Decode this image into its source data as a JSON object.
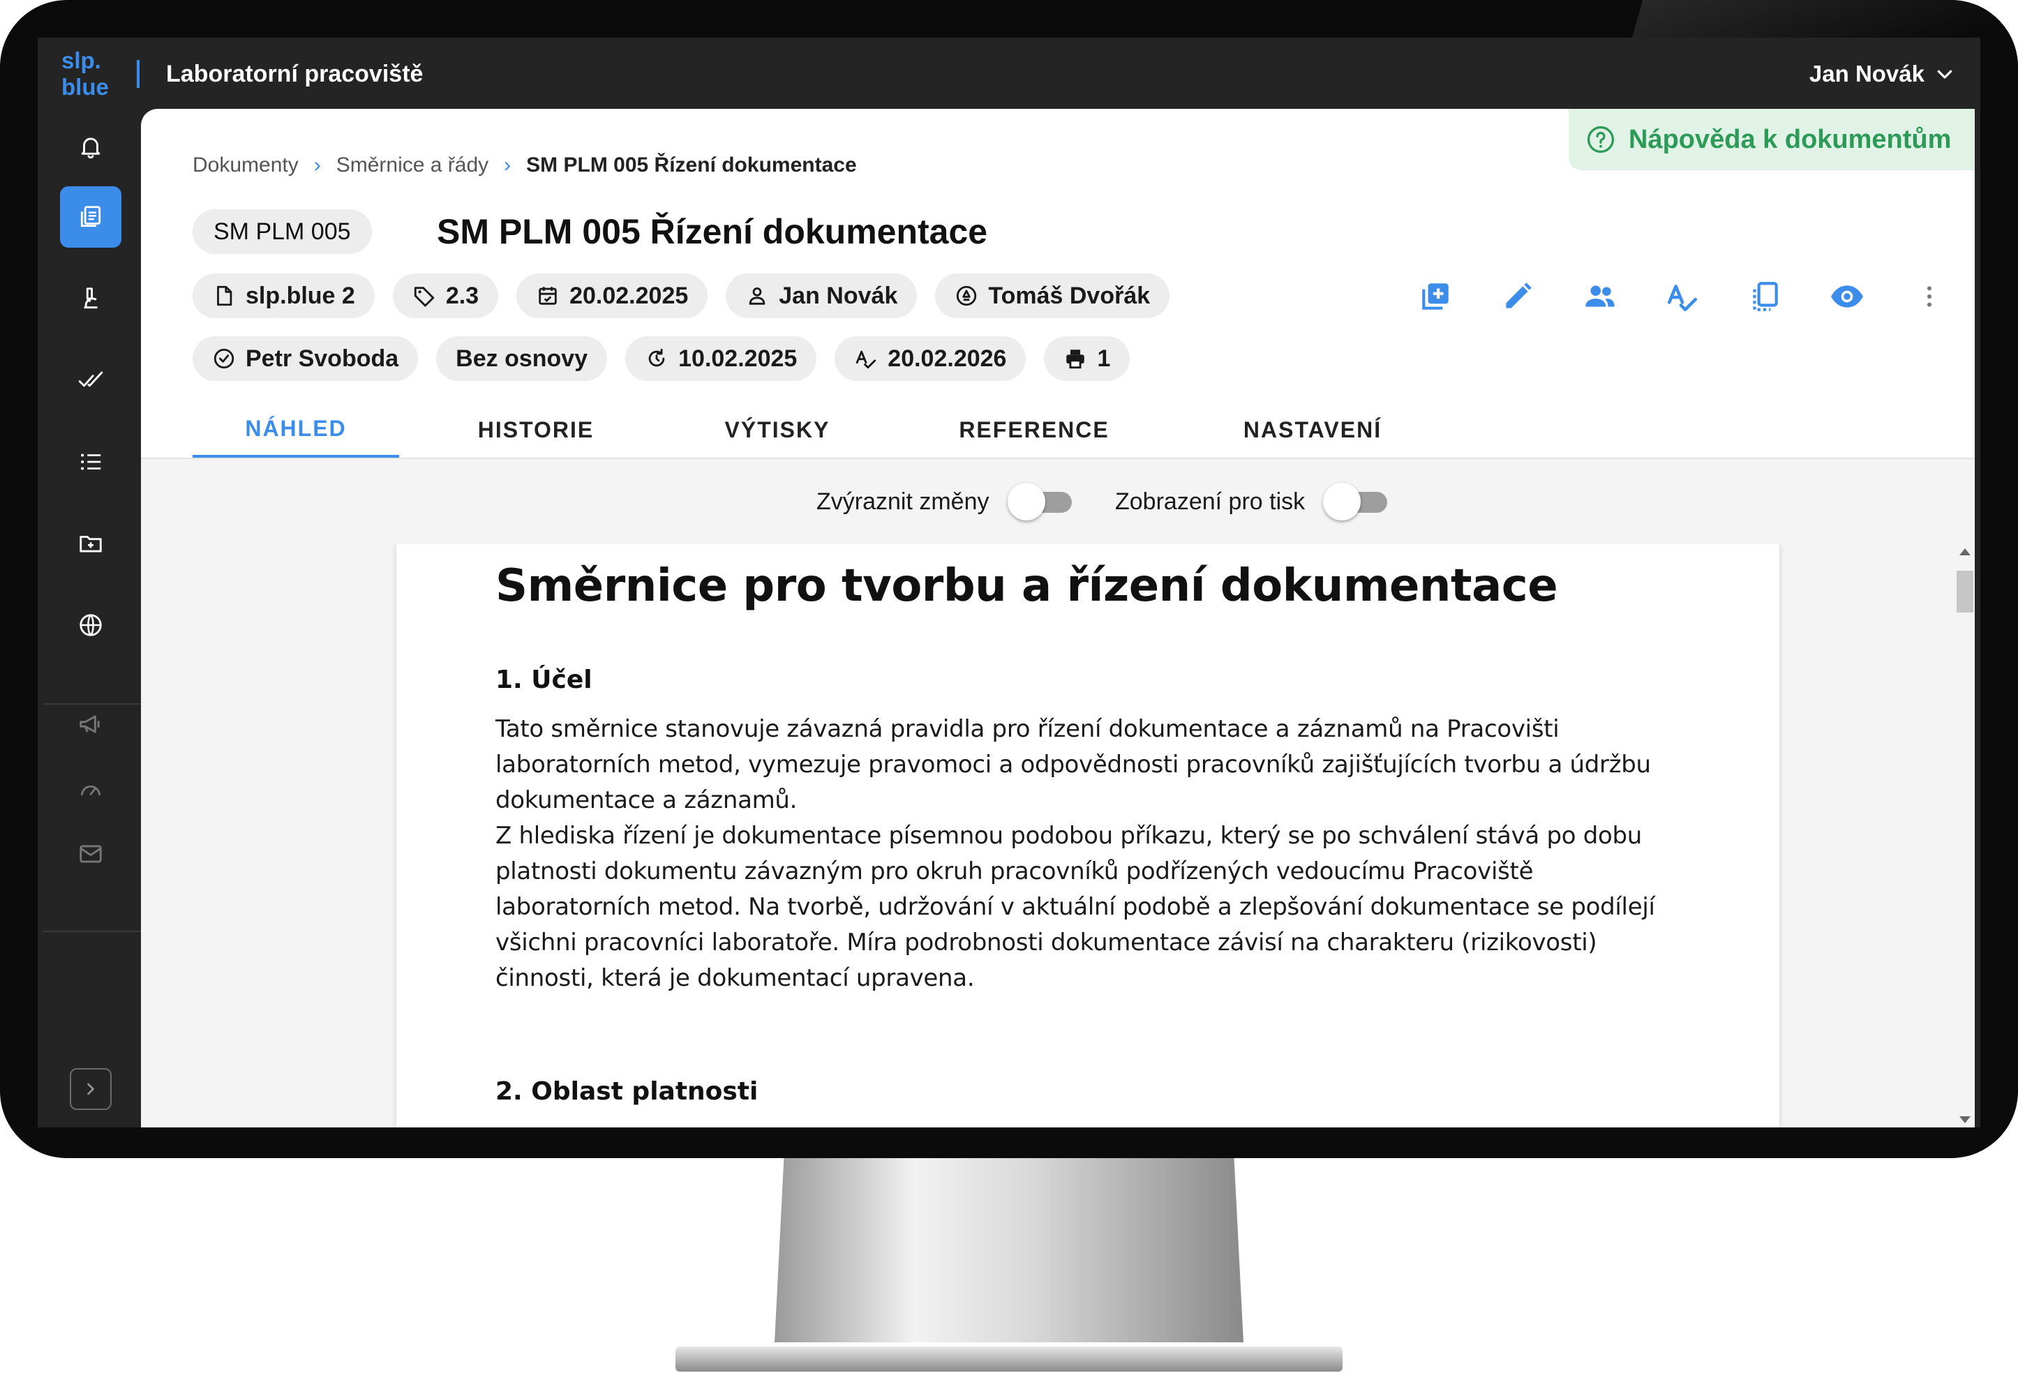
{
  "app": {
    "logo_line1": "slp.",
    "logo_line2": "blue",
    "title": "Laboratorní pracoviště",
    "user_name": "Jan Novák"
  },
  "sidebar": {
    "items": [
      {
        "name": "bell-icon"
      },
      {
        "name": "documents-icon",
        "active": true
      },
      {
        "name": "microscope-icon"
      },
      {
        "name": "double-check-icon"
      },
      {
        "name": "list-icon"
      },
      {
        "name": "folder-add-icon"
      },
      {
        "name": "globe-icon"
      },
      {
        "name": "megaphone-icon"
      },
      {
        "name": "speedometer-icon"
      },
      {
        "name": "mail-icon"
      }
    ],
    "expand_icon": "chevron-right-icon"
  },
  "help": {
    "label": "Nápověda k dokumentům",
    "icon": "help-circle-icon"
  },
  "breadcrumb": [
    {
      "label": "Dokumenty"
    },
    {
      "label": "Směrnice a řády"
    },
    {
      "label": "SM PLM 005 Řízení dokumentace"
    }
  ],
  "document": {
    "code": "SM PLM 005",
    "title": "SM PLM 005 Řízení dokumentace"
  },
  "chips_row1": [
    {
      "icon": "file-icon",
      "label": "slp.blue 2"
    },
    {
      "icon": "tag-icon",
      "label": "2.3"
    },
    {
      "icon": "calendar-icon",
      "label": "20.02.2025"
    },
    {
      "icon": "person-icon",
      "label": "Jan Novák"
    },
    {
      "icon": "approval-icon",
      "label": "Tomáš Dvořák"
    }
  ],
  "chips_row2": [
    {
      "icon": "check-circle-icon",
      "label": "Petr Svoboda"
    },
    {
      "label": "Bez osnovy"
    },
    {
      "icon": "refresh-icon",
      "label": "10.02.2025"
    },
    {
      "icon": "spellcheck-icon",
      "label": "20.02.2026"
    },
    {
      "icon": "printer-icon",
      "label": "1"
    }
  ],
  "toolbar": [
    {
      "name": "add-box-icon"
    },
    {
      "name": "pencil-icon"
    },
    {
      "name": "people-icon"
    },
    {
      "name": "spellcheck-icon"
    },
    {
      "name": "copy-icon"
    },
    {
      "name": "eye-icon"
    },
    {
      "name": "more-vert-icon"
    }
  ],
  "tabs": [
    {
      "label": "NÁHLED",
      "active": true
    },
    {
      "label": "HISTORIE"
    },
    {
      "label": "VÝTISKY"
    },
    {
      "label": "REFERENCE"
    },
    {
      "label": "NASTAVENÍ"
    }
  ],
  "options": {
    "highlight_label": "Zvýraznit změny",
    "highlight_on": false,
    "print_label": "Zobrazení pro tisk",
    "print_on": false
  },
  "content": {
    "heading": "Směrnice pro tvorbu a řízení dokumentace",
    "section1_title": "1. Účel",
    "section1_lines": [
      "Tato směrnice stanovuje závazná pravidla pro řízení dokumentace a záznamů na Pracovišti",
      "laboratorních metod, vymezuje pravomoci a odpovědnosti pracovníků zajišťujících tvorbu a údržbu",
      "dokumentace a záznamů.",
      "Z hlediska řízení je dokumentace písemnou podobou příkazu, který se po schválení stává po dobu",
      "platnosti dokumentu závazným pro okruh pracovníků podřízených vedoucímu Pracoviště",
      "laboratorních metod. Na tvorbě, udržování v aktuální podobě a zlepšování dokumentace se podílejí",
      "všichni pracovníci laboratoře. Míra podrobnosti dokumentace závisí na charakteru (rizikovosti)",
      "činnosti, která je dokumentací upravena."
    ],
    "section2_title": "2. Oblast platnosti"
  },
  "colors": {
    "accent": "#3c8dea",
    "help_green": "#2e9a58",
    "help_bg": "#e1f3e7",
    "chrome": "#242424"
  }
}
